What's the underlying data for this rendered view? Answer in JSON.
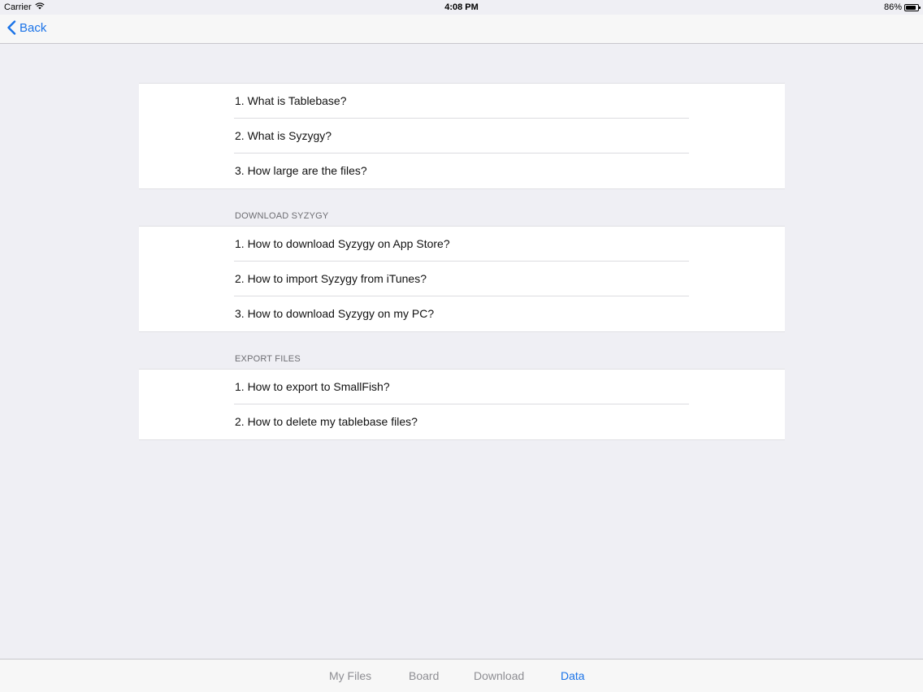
{
  "status_bar": {
    "carrier": "Carrier",
    "wifi_icon": "wifi-icon",
    "time": "4:08 PM",
    "battery_percent": "86%",
    "battery_level": 0.86
  },
  "nav": {
    "back_label": "Back",
    "back_icon": "chevron-left-icon",
    "accent_color": "#1a73e8"
  },
  "sections": [
    {
      "header": "",
      "items": [
        {
          "label": "1. What is Tablebase?"
        },
        {
          "label": "2. What is Syzygy?"
        },
        {
          "label": "3. How large are the files?"
        }
      ]
    },
    {
      "header": "DOWNLOAD SYZYGY",
      "items": [
        {
          "label": "1. How to download Syzygy on App Store?"
        },
        {
          "label": "2. How to import Syzygy from iTunes?"
        },
        {
          "label": "3. How to download Syzygy on my PC?"
        }
      ]
    },
    {
      "header": "EXPORT FILES",
      "items": [
        {
          "label": "1. How to export to SmallFish?"
        },
        {
          "label": "2. How to delete my tablebase files?"
        }
      ]
    }
  ],
  "tab_bar": {
    "tabs": [
      {
        "label": "My Files"
      },
      {
        "label": "Board"
      },
      {
        "label": "Download"
      },
      {
        "label": "Data",
        "active": true
      }
    ]
  }
}
